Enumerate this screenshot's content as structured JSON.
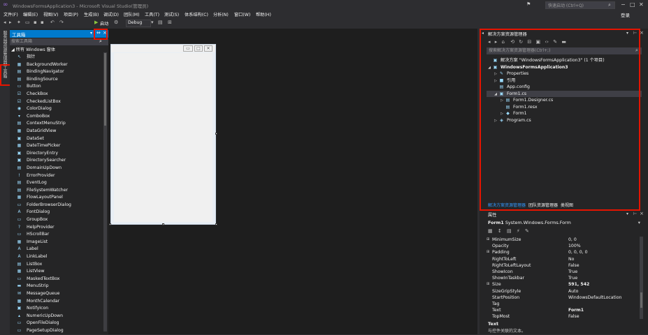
{
  "window": {
    "title": "WindowsFormsApplication3 - Microsoft Visual Studio(管理员)",
    "quick_launch_placeholder": "快速启动 (Ctrl+Q)",
    "login": "登录"
  },
  "menu": [
    "文件(F)",
    "编辑(E)",
    "视图(V)",
    "项目(P)",
    "生成(B)",
    "调试(D)",
    "团队(M)",
    "工具(T)",
    "测试(S)",
    "体系结构(C)",
    "分析(N)",
    "窗口(W)",
    "帮助(H)"
  ],
  "toolbar": {
    "start_label": "启动",
    "config": "Debug"
  },
  "vertical_tabs": [
    "服务器资源管理器",
    "工具箱"
  ],
  "toolbox": {
    "title": "工具箱",
    "search_placeholder": "搜索工具箱",
    "group": "所有 Windows 窗体",
    "items": [
      "指针",
      "BackgroundWorker",
      "BindingNavigator",
      "BindingSource",
      "Button",
      "CheckBox",
      "CheckedListBox",
      "ColorDialog",
      "ComboBox",
      "ContextMenuStrip",
      "DataGridView",
      "DataSet",
      "DateTimePicker",
      "DirectoryEntry",
      "DirectorySearcher",
      "DomainUpDown",
      "ErrorProvider",
      "EventLog",
      "FileSystemWatcher",
      "FlowLayoutPanel",
      "FolderBrowserDialog",
      "FontDialog",
      "GroupBox",
      "HelpProvider",
      "HScrollBar",
      "ImageList",
      "Label",
      "LinkLabel",
      "ListBox",
      "ListView",
      "MaskedTextBox",
      "MenuStrip",
      "MessageQueue",
      "MonthCalendar",
      "NotifyIcon",
      "NumericUpDown",
      "OpenFileDialog",
      "PageSetupDialog"
    ]
  },
  "solution_explorer": {
    "title": "解决方案资源管理器",
    "search_placeholder": "搜索解决方案资源管理器(Ctrl+;)",
    "tree": [
      {
        "label": "解决方案 \"WindowsFormsApplication3\" (1 个项目)",
        "indent": 0,
        "arrow": "",
        "icon": "▣"
      },
      {
        "label": "WindowsFormsApplication3",
        "indent": 0,
        "arrow": "◢",
        "icon": "▣",
        "bold": true
      },
      {
        "label": "Properties",
        "indent": 1,
        "arrow": "▷",
        "icon": "✎"
      },
      {
        "label": "引用",
        "indent": 1,
        "arrow": "▷",
        "icon": "■"
      },
      {
        "label": "App.config",
        "indent": 1,
        "arrow": "",
        "icon": "▤"
      },
      {
        "label": "Form1.cs",
        "indent": 1,
        "arrow": "◢",
        "icon": "▣",
        "selected": true
      },
      {
        "label": "Form1.Designer.cs",
        "indent": 2,
        "arrow": "▷",
        "icon": "▤"
      },
      {
        "label": "Form1.resx",
        "indent": 2,
        "arrow": "",
        "icon": "▤"
      },
      {
        "label": "Form1",
        "indent": 2,
        "arrow": "▷",
        "icon": "◆"
      },
      {
        "label": "Program.cs",
        "indent": 1,
        "arrow": "▷",
        "icon": "◈"
      }
    ],
    "tabs": [
      "解决方案资源管理器",
      "团队资源管理器",
      "类视图"
    ]
  },
  "properties": {
    "title": "属性",
    "object": "Form1",
    "object_type": "System.Windows.Forms.Form",
    "rows": [
      {
        "name": "MinimumSize",
        "value": "0, 0",
        "expand": true
      },
      {
        "name": "Opacity",
        "value": "100%"
      },
      {
        "name": "Padding",
        "value": "0, 0, 0, 0",
        "expand": true
      },
      {
        "name": "RightToLeft",
        "value": "No"
      },
      {
        "name": "RightToLeftLayout",
        "value": "False"
      },
      {
        "name": "ShowIcon",
        "value": "True"
      },
      {
        "name": "ShowInTaskbar",
        "value": "True"
      },
      {
        "name": "Size",
        "value": "591, 542",
        "expand": true,
        "bold": true
      },
      {
        "name": "SizeGripStyle",
        "value": "Auto"
      },
      {
        "name": "StartPosition",
        "value": "WindowsDefaultLocation"
      },
      {
        "name": "Tag",
        "value": ""
      },
      {
        "name": "Text",
        "value": "Form1",
        "bold": true
      },
      {
        "name": "TopMost",
        "value": "False"
      }
    ],
    "desc_title": "Text",
    "desc_text": "与控件关联的文本。"
  },
  "colors": {
    "accent": "#007acc",
    "highlight": "#e51400"
  }
}
